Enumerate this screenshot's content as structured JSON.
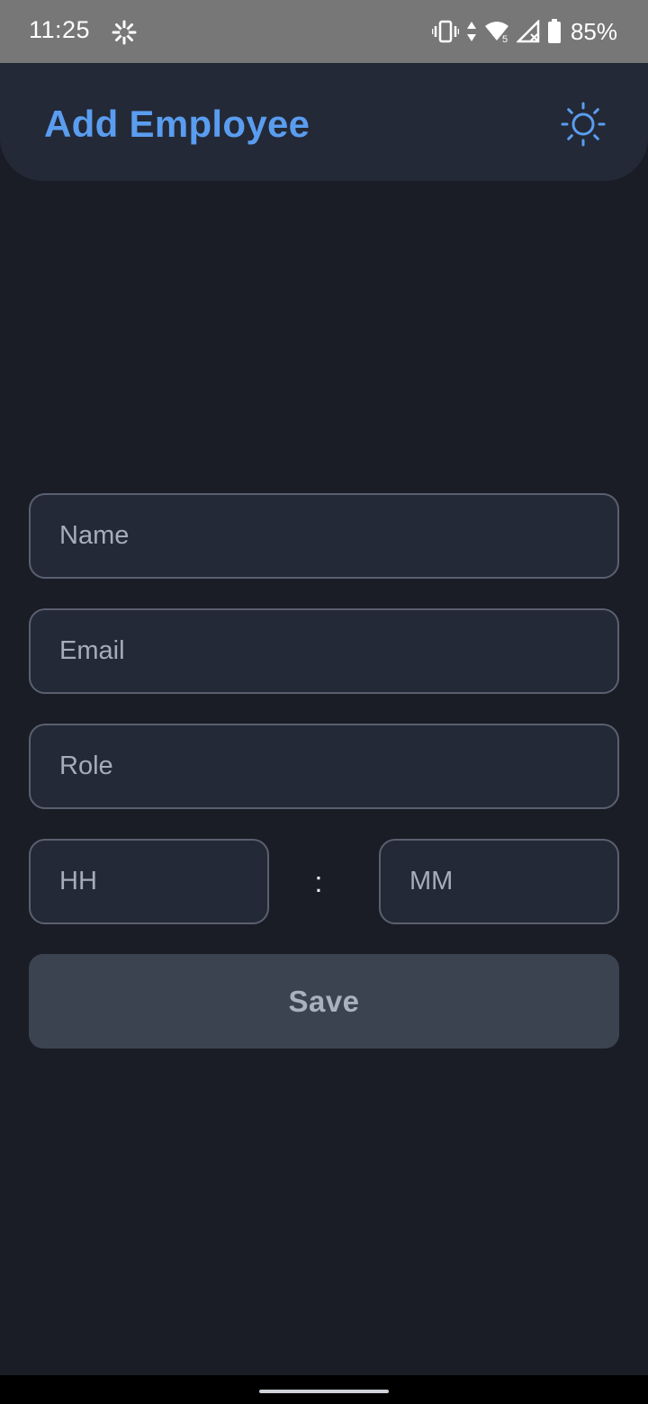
{
  "status_bar": {
    "time": "11:25",
    "battery_percent": "85%",
    "icons": [
      "settings-gear-icon",
      "vibrate-icon",
      "data-arrows-icon",
      "wifi-icon",
      "signal-icon",
      "battery-icon"
    ]
  },
  "app_bar": {
    "title": "Add Employee",
    "theme_icon": "sun-icon",
    "accent_color": "#5a9df0"
  },
  "form": {
    "name_placeholder": "Name",
    "email_placeholder": "Email",
    "role_placeholder": "Role",
    "hour_placeholder": "HH",
    "minute_placeholder": "MM",
    "time_separator": ":",
    "save_label": "Save"
  },
  "colors": {
    "background": "#1a1d26",
    "surface": "#232936",
    "button": "#3c4350"
  }
}
